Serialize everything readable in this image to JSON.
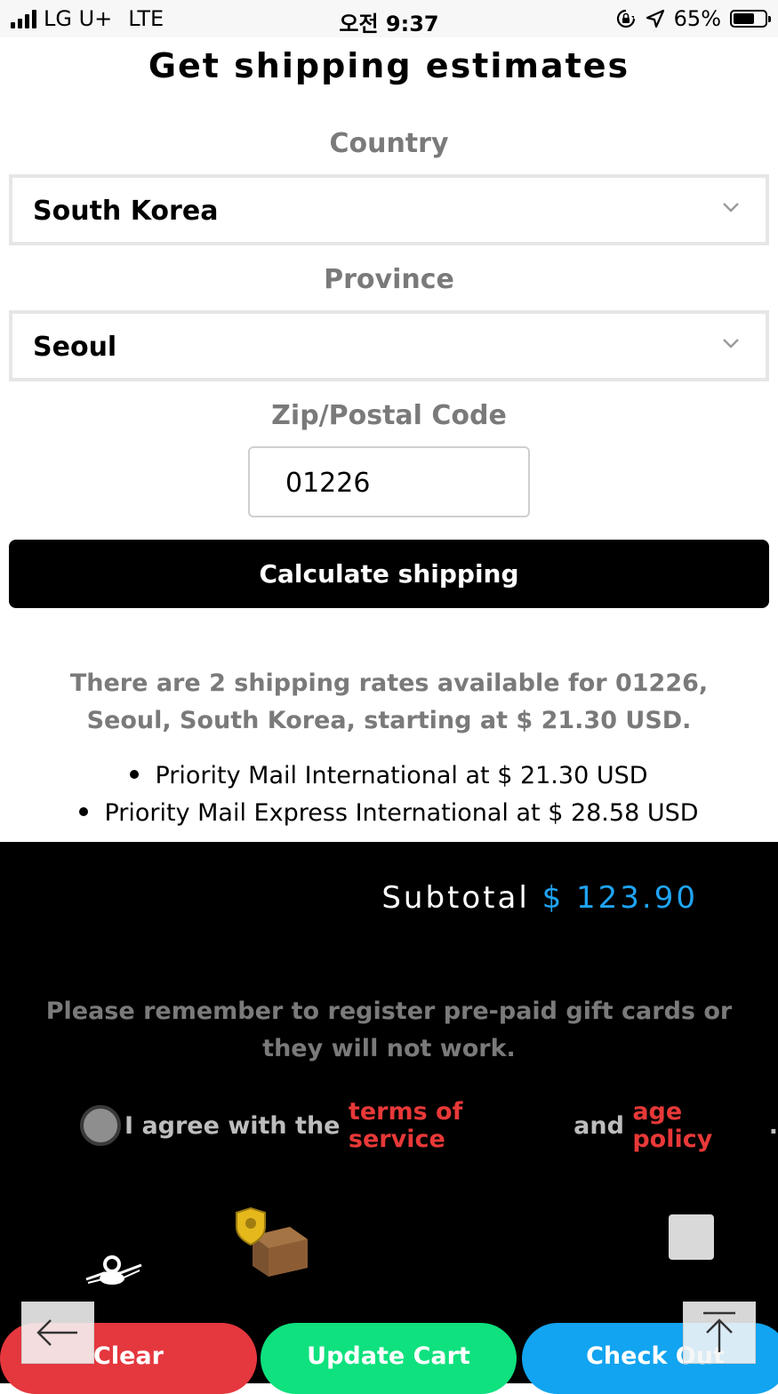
{
  "status_bar": {
    "carrier": "LG U+",
    "network": "LTE",
    "time": "오전 9:37",
    "battery": "65%",
    "icons": [
      "signal-icon",
      "rotation-lock-icon",
      "location-icon",
      "battery-icon"
    ]
  },
  "shipping": {
    "title": "Get shipping estimates",
    "country_label": "Country",
    "country_value": "South Korea",
    "province_label": "Province",
    "province_value": "Seoul",
    "zip_label": "Zip/Postal Code",
    "zip_value": "01226",
    "calculate_label": "Calculate shipping",
    "rates_message": "There are 2 shipping rates available for 01226, Seoul, South Korea, starting at $ 21.30 USD.",
    "rates": [
      "Priority Mail International at $ 21.30 USD",
      "Priority Mail Express International at $ 28.58 USD"
    ]
  },
  "cart_footer": {
    "subtotal_label": "Subtotal",
    "subtotal_value": "$ 123.90",
    "gift_card_notice": "Please remember to register pre-paid gift cards or they will not work.",
    "agree_prefix": "I agree with the ",
    "terms_link": "terms of service",
    "agree_middle": " and ",
    "age_link": "age policy",
    "agree_suffix": ".",
    "buttons": {
      "clear": "Clear",
      "update": "Update Cart",
      "checkout": "Check Out"
    }
  },
  "colors": {
    "subtotal_accent": "#1fa4f4",
    "link_red": "#e83838",
    "clear_btn": "#e5373e",
    "update_btn": "#0fe17e",
    "checkout_btn": "#12a4f0"
  },
  "nav": {
    "back_icon": "arrow-left-icon",
    "top_icon": "arrow-up-to-top-icon"
  }
}
